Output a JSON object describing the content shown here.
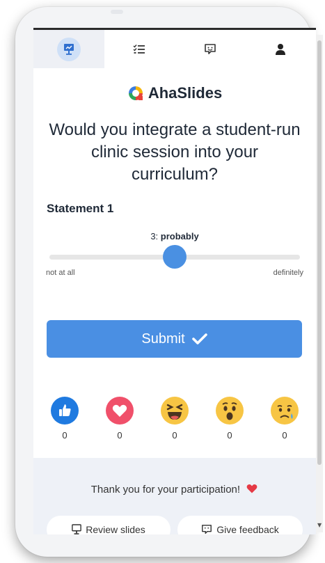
{
  "tabs": [
    {
      "name": "present",
      "icon": "presentation-icon",
      "active": true
    },
    {
      "name": "questions",
      "icon": "list-checks-icon",
      "active": false
    },
    {
      "name": "feedback",
      "icon": "feedback-icon",
      "active": false
    },
    {
      "name": "profile",
      "icon": "user-icon",
      "active": false
    }
  ],
  "brand": {
    "name": "AhaSlides",
    "icon": "ahaslides-logo-icon"
  },
  "question": "Would you integrate a student-run clinic session into your curriculum?",
  "statement": {
    "label": "Statement 1"
  },
  "slider": {
    "value": 3,
    "value_label": "3:",
    "value_word": "probably",
    "min": 1,
    "max": 5,
    "min_label": "not at all",
    "max_label": "definitely"
  },
  "submit": {
    "label": "Submit"
  },
  "reactions": [
    {
      "name": "like",
      "icon": "thumbs-up-icon",
      "count": "0"
    },
    {
      "name": "love",
      "icon": "heart-icon",
      "count": "0"
    },
    {
      "name": "haha",
      "icon": "laughing-face-icon",
      "count": "0"
    },
    {
      "name": "wow",
      "icon": "surprised-face-icon",
      "count": "0"
    },
    {
      "name": "sad",
      "icon": "sad-face-icon",
      "count": "0"
    }
  ],
  "footer": {
    "thanks": "Thank you for your participation!",
    "review_label": "Review slides",
    "feedback_label": "Give feedback"
  },
  "colors": {
    "primary": "#4a8fe3",
    "heart": "#e53945",
    "tab_active_bg": "#cfe0f7"
  }
}
